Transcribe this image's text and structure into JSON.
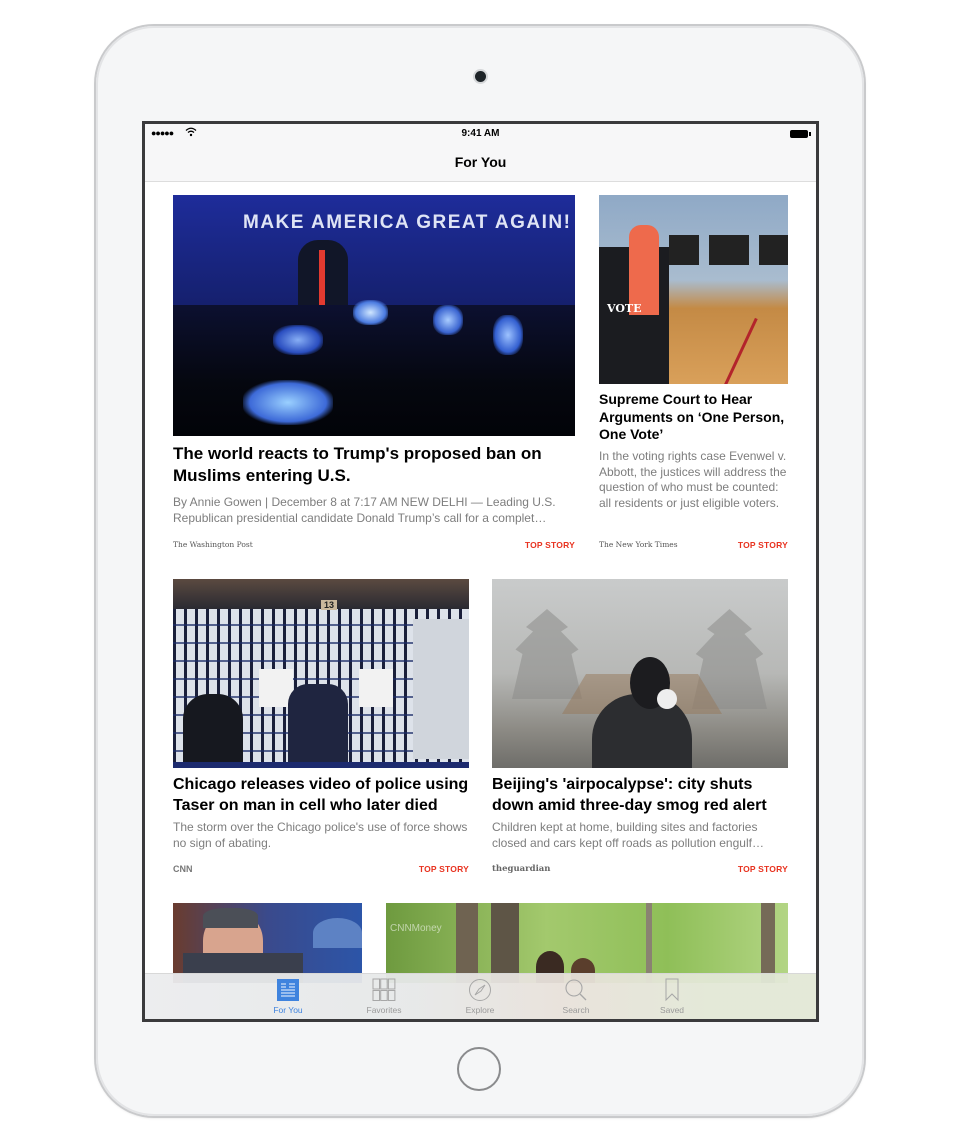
{
  "status_bar": {
    "time": "9:41 AM",
    "signal": "●●●●●",
    "wifi_icon": "wifi-icon",
    "battery_icon": "battery-icon"
  },
  "nav": {
    "title": "For You"
  },
  "articles": [
    {
      "title": "The world reacts to Trump's proposed ban on Muslims entering U.S.",
      "description": "By Annie Gowen | December 8 at 7:17 AM NEW DELHI — Leading U.S. Republican presidential candidate Donald Trump’s call for a complet…",
      "source": "The Washington Post",
      "badge": "TOP STORY",
      "image_text": "MAKE AMERICA GREAT AGAIN!"
    },
    {
      "title": "Supreme Court to Hear Arguments on ‘One Person, One Vote’",
      "description": "In the voting rights case Evenwel v. Abbott, the justices will address the question of who must be counted: all residents or just eligible voters.",
      "source": "The New York Times",
      "badge": "TOP STORY",
      "image_text": "VOTE"
    },
    {
      "title": "Chicago releases video of police using Taser on man in cell who later died",
      "description": "The storm over the Chicago police's use of force shows no sign of abating.",
      "source": "CNN",
      "badge": "TOP STORY",
      "image_text": "13"
    },
    {
      "title": "Beijing's 'airpocalypse': city shuts down amid three-day smog red alert",
      "description": "Children kept at home, building sites and factories closed and cars kept off roads as pollution engulf…",
      "source": "theguardian",
      "badge": "TOP STORY"
    },
    {
      "image_text": ""
    },
    {
      "image_text": "CNNMoney"
    }
  ],
  "tabs": [
    {
      "label": "For You",
      "icon": "news-icon",
      "active": true
    },
    {
      "label": "Favorites",
      "icon": "grid-icon",
      "active": false
    },
    {
      "label": "Explore",
      "icon": "compass-icon",
      "active": false
    },
    {
      "label": "Search",
      "icon": "search-icon",
      "active": false
    },
    {
      "label": "Saved",
      "icon": "bookmark-icon",
      "active": false
    }
  ],
  "colors": {
    "accent": "#3f83de",
    "badge": "#e8321f"
  }
}
